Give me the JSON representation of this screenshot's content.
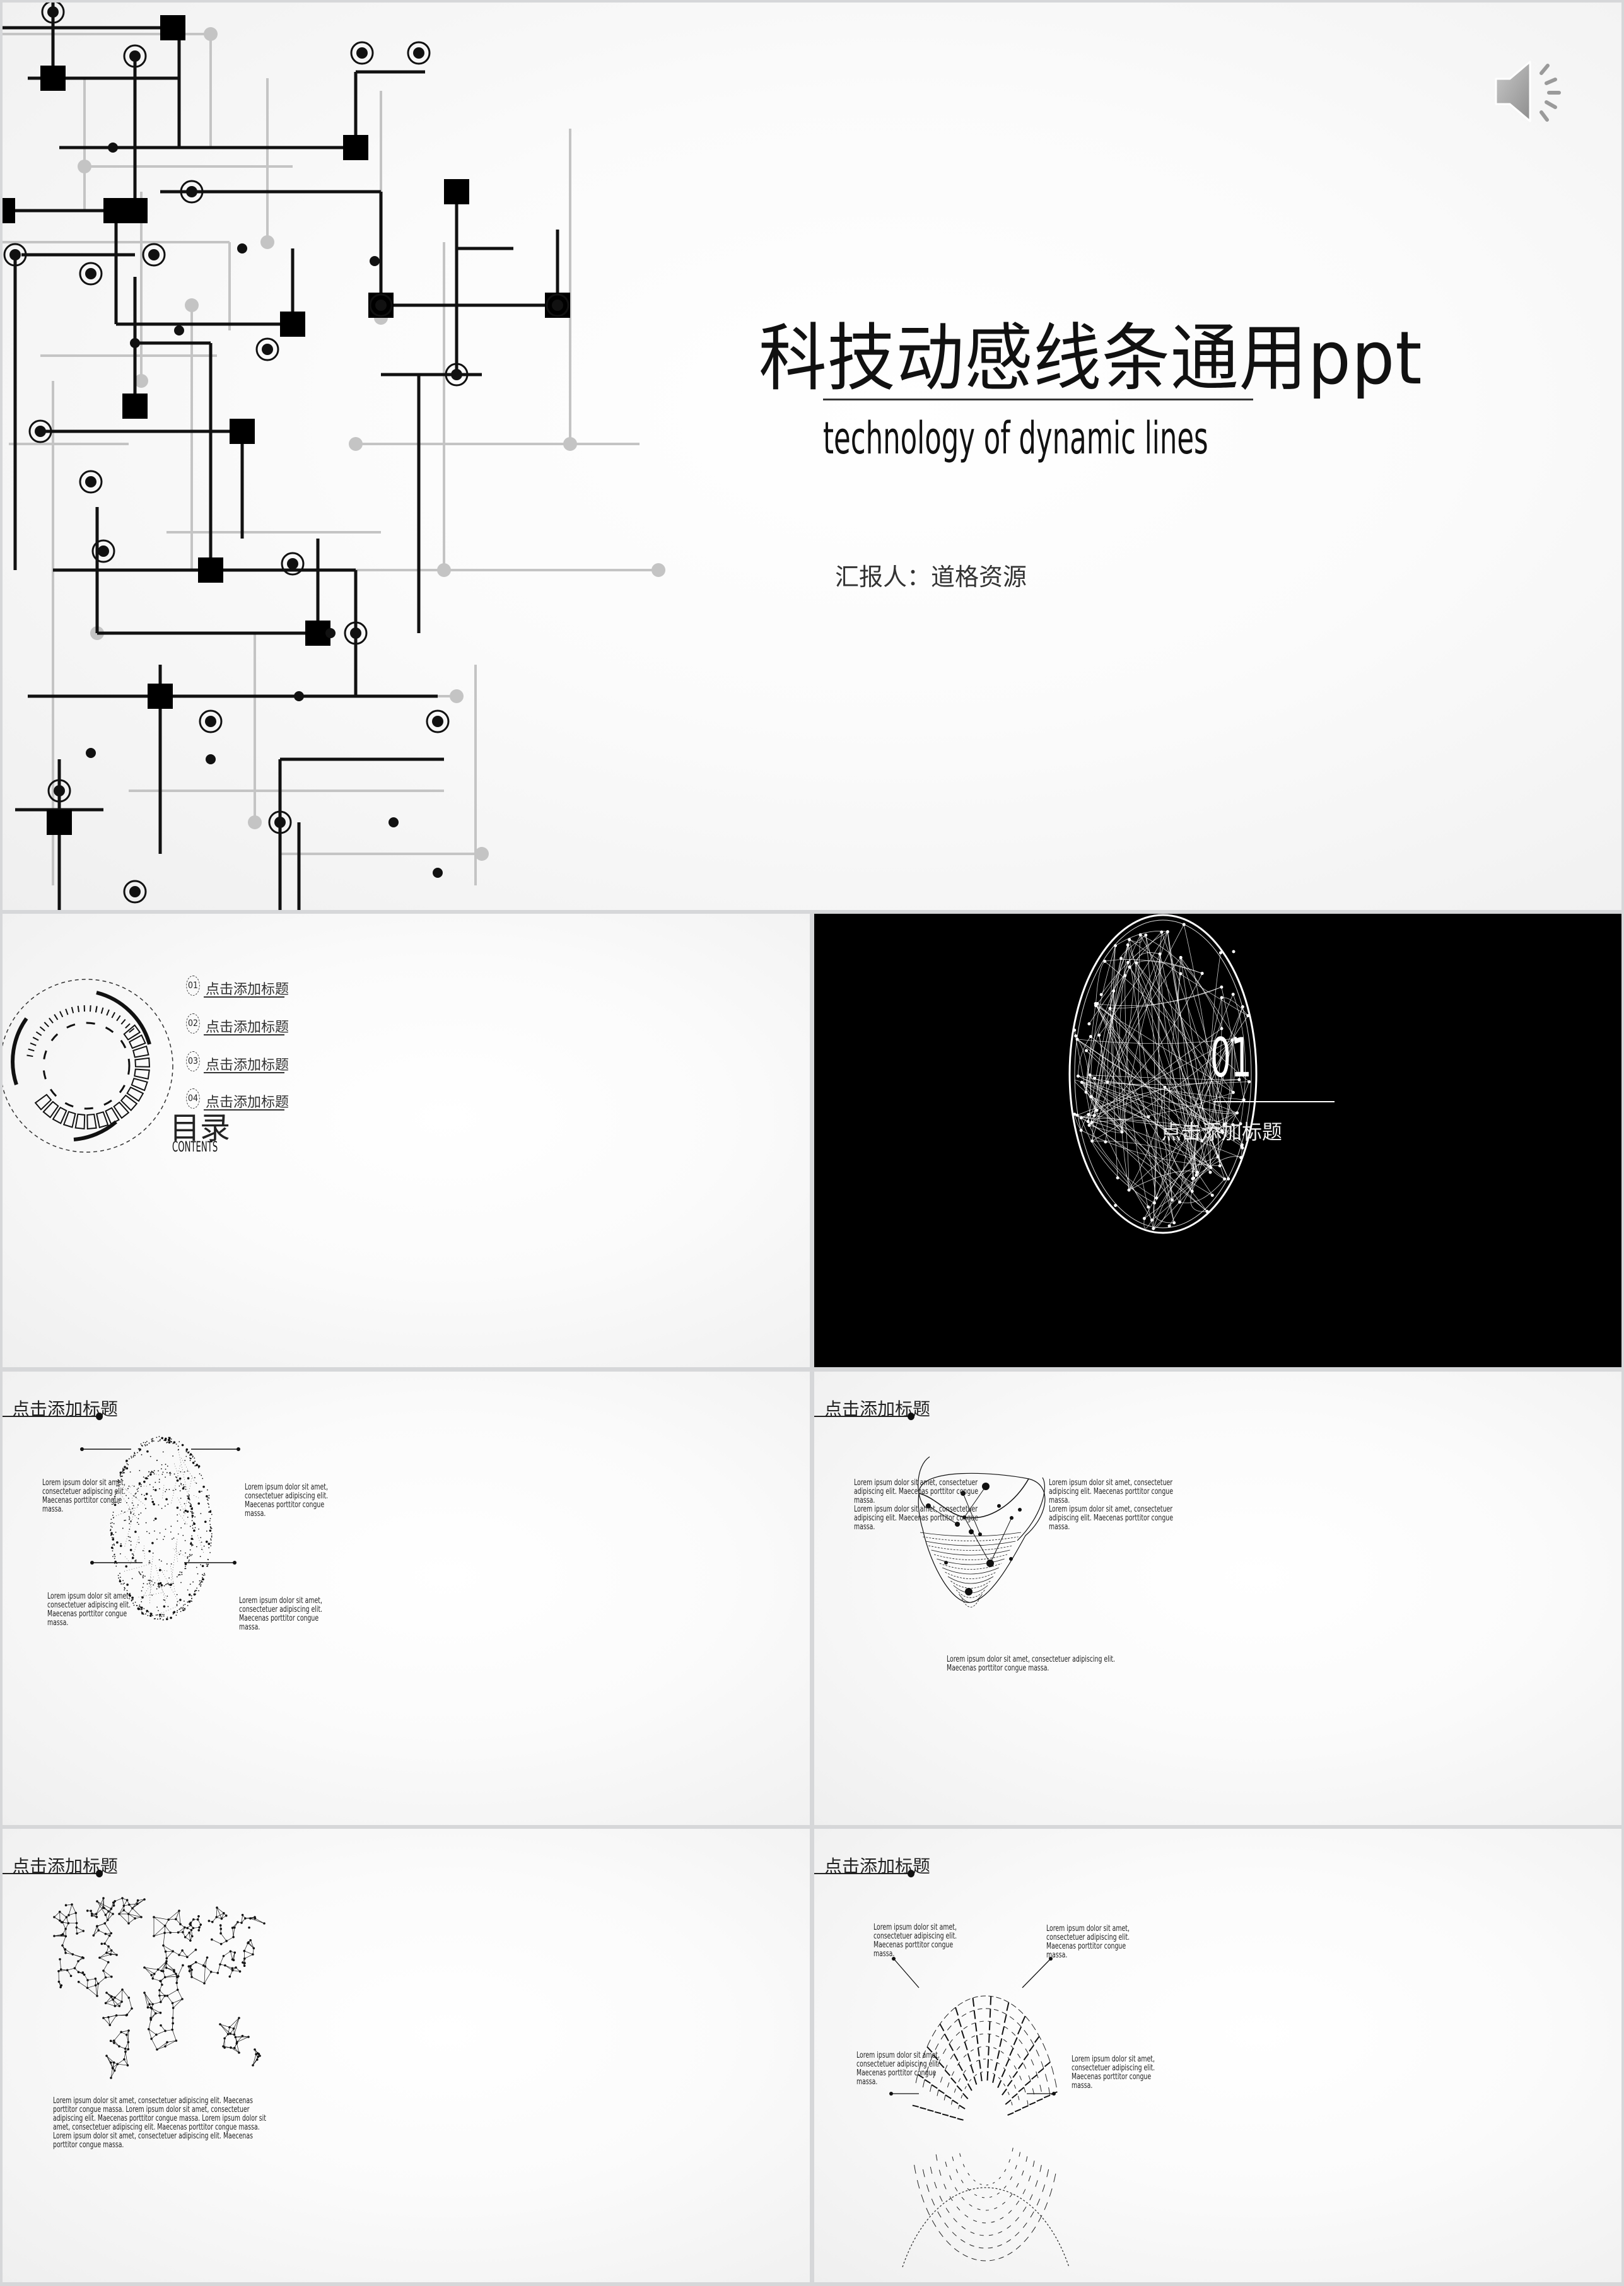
{
  "title_slide": {
    "title": "科技动感线条通用ppt",
    "subtitle": "technology of dynamic lines",
    "reporter": "汇报人：道格资源",
    "audio_icon": "speaker-volume-icon",
    "decoration": "circuit-lines-icon"
  },
  "toc_slide": {
    "center_cn": "目录",
    "center_en": "CONTENTS",
    "items": [
      {
        "num": "01",
        "label": "点击添加标题"
      },
      {
        "num": "02",
        "label": "点击添加标题"
      },
      {
        "num": "03",
        "label": "点击添加标题"
      },
      {
        "num": "04",
        "label": "点击添加标题"
      }
    ]
  },
  "section_slide": {
    "number": "01",
    "label": "点击添加标题",
    "graphic": "network-sphere-icon"
  },
  "sphere_slide": {
    "title": "点击添加标题",
    "graphic": "dotted-sphere-icon",
    "callouts": [
      "Lorem ipsum dolor sit amet,\nconsectetuer adipiscing elit.\nMaecenas porttitor congue\nmassa.",
      "Lorem ipsum dolor sit amet,\nconsectetuer adipiscing elit.\nMaecenas porttitor congue\nmassa.",
      "Lorem ipsum dolor sit amet,\nconsectetuer adipiscing elit.\nMaecenas porttitor congue\nmassa.",
      "Lorem ipsum dolor sit amet,\nconsectetuer adipiscing elit.\nMaecenas porttitor congue\nmassa."
    ]
  },
  "bowl_slide": {
    "title": "点击添加标题",
    "graphic": "circuit-bowl-icon",
    "left_text": "Lorem ipsum dolor sit amet, consectetuer\nadipiscing elit. Maecenas porttitor congue\nmassa.\n Lorem ipsum dolor sit amet, consectetuer\nadipiscing elit. Maecenas porttitor congue\nmassa.",
    "right_text": "Lorem ipsum dolor sit amet, consectetuer\nadipiscing elit. Maecenas porttitor congue\nmassa.\n Lorem ipsum dolor sit amet, consectetuer\nadipiscing elit. Maecenas porttitor congue\nmassa.",
    "bottom_text": "Lorem ipsum dolor sit amet, consectetuer adipiscing elit.\nMaecenas porttitor congue massa."
  },
  "map_slide": {
    "title": "点击添加标题",
    "graphic": "polygon-world-map-icon",
    "body": "Lorem ipsum dolor sit amet, consectetuer adipiscing elit. Maecenas porttitor congue massa. Lorem ipsum dolor sit amet, consectetuer adipiscing elit. Maecenas porttitor congue massa. Lorem ipsum dolor sit amet, consectetuer adipiscing elit. Maecenas porttitor congue massa. Lorem ipsum dolor sit amet, consectetuer adipiscing elit. Maecenas porttitor congue massa."
  },
  "ring_slide": {
    "title": "点击添加标题",
    "graphic": "circuit-ring-icon",
    "callouts": [
      "Lorem ipsum dolor sit amet,\nconsectetuer adipiscing elit.\nMaecenas porttitor congue\nmassa.",
      "Lorem ipsum dolor sit amet,\nconsectetuer adipiscing elit.\nMaecenas porttitor congue\nmassa.",
      "Lorem ipsum dolor sit amet,\nconsectetuer adipiscing elit.\nMaecenas porttitor congue\nmassa.",
      "Lorem ipsum dolor sit amet,\nconsectetuer adipiscing elit.\nMaecenas porttitor congue\nmassa."
    ]
  }
}
